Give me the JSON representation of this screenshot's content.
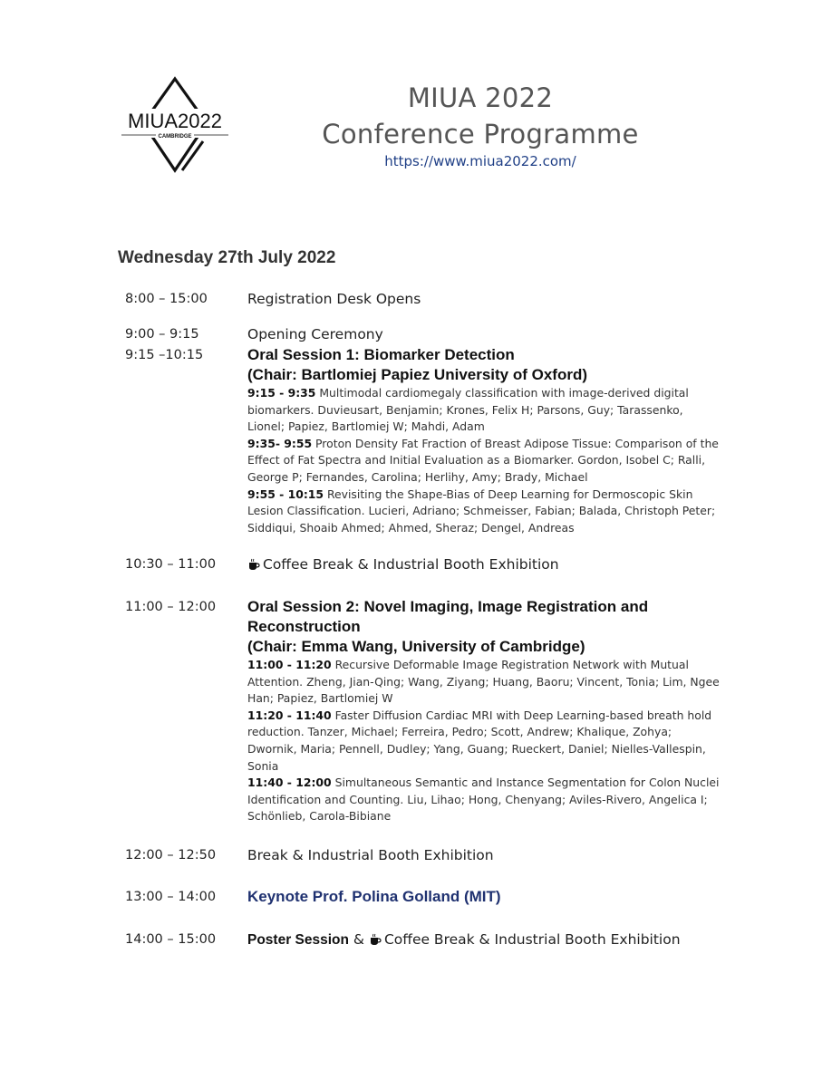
{
  "logo": {
    "name": "MIUA2022",
    "sub": "CAMBRIDGE"
  },
  "header": {
    "title_line1": "MIUA 2022",
    "title_line2": "Conference Programme",
    "url": "https://www.miua2022.com/"
  },
  "day": "Wednesday 27th July 2022",
  "schedule": {
    "registration": {
      "time": "8:00 – 15:00",
      "text": "Registration Desk Opens"
    },
    "opening": {
      "time": "9:00 – 9:15",
      "text": "Opening Ceremony"
    },
    "oral1": {
      "time": "9:15 –10:15",
      "title": "Oral Session 1:  Biomarker Detection",
      "chair": "(Chair: Bartlomiej Papiez University of Oxford)",
      "papers": [
        {
          "time": "9:15 - 9:35",
          "text": " Multimodal cardiomegaly classification with image-derived digital biomarkers.   Duvieusart, Benjamin; Krones, Felix H; Parsons, Guy; Tarassenko, Lionel; Papiez, Bartlomiej W; Mahdi, Adam"
        },
        {
          "time": "9:35- 9:55",
          "text": " Proton Density Fat Fraction of Breast Adipose Tissue: Comparison of the Effect of Fat Spectra and Initial Evaluation as a Biomarker. Gordon, Isobel C; Ralli, George P; Fernandes, Carolina; Herlihy, Amy; Brady, Michael"
        },
        {
          "time": "9:55 - 10:15",
          "text": " Revisiting the Shape-Bias of Deep Learning for Dermoscopic Skin Lesion Classification. Lucieri, Adriano; Schmeisser, Fabian; Balada, Christoph Peter; Siddiqui, Shoaib Ahmed; Ahmed, Sheraz; Dengel, Andreas"
        }
      ]
    },
    "coffee1": {
      "time": "10:30 – 11:00",
      "text": "Coffee Break   & Industrial Booth Exhibition"
    },
    "oral2": {
      "time": "11:00 – 12:00",
      "title": "Oral Session 2:  Novel Imaging, Image Registration and Reconstruction",
      "chair": "(Chair: Emma Wang, University of Cambridge)",
      "papers": [
        {
          "time": "11:00 - 11:20",
          "text": " Recursive Deformable Image Registration Network with Mutual Attention. Zheng, Jian-Qing; Wang, Ziyang; Huang, Baoru; Vincent, Tonia; Lim, Ngee Han; Papiez, Bartlomiej W"
        },
        {
          "time": "11:20 - 11:40",
          "text": " Faster Diffusion Cardiac MRI with Deep Learning-based breath hold reduction. Tanzer, Michael; Ferreira, Pedro; Scott, Andrew; Khalique, Zohya; Dwornik, Maria; Pennell, Dudley; Yang, Guang; Rueckert, Daniel; Nielles-Vallespin, Sonia"
        },
        {
          "time": "11:40 - 12:00",
          "text": " Simultaneous Semantic and Instance Segmentation for Colon Nuclei Identification and Counting. Liu, Lihao; Hong, Chenyang; Aviles-Rivero, Angelica I; Schönlieb, Carola-Bibiane"
        }
      ]
    },
    "break": {
      "time": "12:00 – 12:50",
      "text": "Break & Industrial Booth Exhibition"
    },
    "keynote": {
      "time": "13:00 – 14:00",
      "text": "Keynote Prof. Polina Golland  (MIT)"
    },
    "poster": {
      "time": "14:00 – 15:00",
      "bold": "Poster Session",
      "amp": " & ",
      "text": "Coffee Break  & Industrial Booth Exhibition"
    }
  }
}
